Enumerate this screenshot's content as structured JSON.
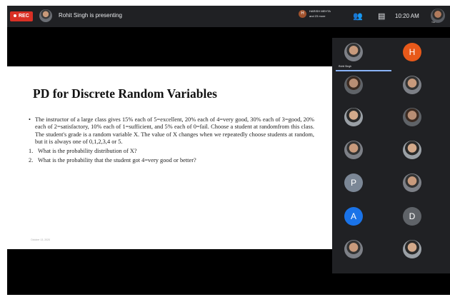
{
  "recording": {
    "label": "REC"
  },
  "topbar": {
    "presenting_text": "Rohit Singh is presenting",
    "host_initial": "H",
    "host_line1": "HARISH MEHTA",
    "host_line2": "and 23 more",
    "people_icon": "people-icon",
    "chat_icon": "chat-icon",
    "clock": "10:20 AM",
    "self_label": "You"
  },
  "slide": {
    "title": "PD for Discrete Random Variables",
    "bullet": "•",
    "paragraph": "The instructor of a large class gives 15% each of 5=excellent, 20% each of 4=very good, 30% each of 3=good, 20% each of 2=satisfactory, 10% each of 1=sufficient, and 5% each of 0=fail. Choose a student at randomfrom this class. The student's grade is a random variable X. The value of X changes when we repeatedly choose students at random, but it is always one of 0,1,2,3,4 or 5.",
    "questions": [
      {
        "num": "1.",
        "text": "What is the probability distribution of X?"
      },
      {
        "num": "2.",
        "text": "What is the probability that the student got 4=very good or better?"
      }
    ],
    "footer": "October 13, 2020"
  },
  "participants": {
    "presenter_label": "Rohit Singh",
    "tiles": [
      {
        "kind": "photo",
        "letter": "",
        "color": ""
      },
      {
        "kind": "letter",
        "letter": "H",
        "color": "#e8591a"
      },
      {
        "kind": "photo",
        "letter": "",
        "color": ""
      },
      {
        "kind": "photo",
        "letter": "",
        "color": ""
      },
      {
        "kind": "photo",
        "letter": "",
        "color": ""
      },
      {
        "kind": "photo",
        "letter": "",
        "color": ""
      },
      {
        "kind": "photo",
        "letter": "",
        "color": ""
      },
      {
        "kind": "photo",
        "letter": "",
        "color": ""
      },
      {
        "kind": "letter",
        "letter": "P",
        "color": "#7b8796"
      },
      {
        "kind": "photo",
        "letter": "",
        "color": ""
      },
      {
        "kind": "letter",
        "letter": "A",
        "color": "#1a73e8"
      },
      {
        "kind": "letter",
        "letter": "D",
        "color": "#5f6368"
      },
      {
        "kind": "photo",
        "letter": "",
        "color": ""
      },
      {
        "kind": "photo",
        "letter": "",
        "color": ""
      }
    ]
  },
  "colors": {
    "accent": "#8ab4f8",
    "rec": "#d93025",
    "background": "#202124"
  }
}
